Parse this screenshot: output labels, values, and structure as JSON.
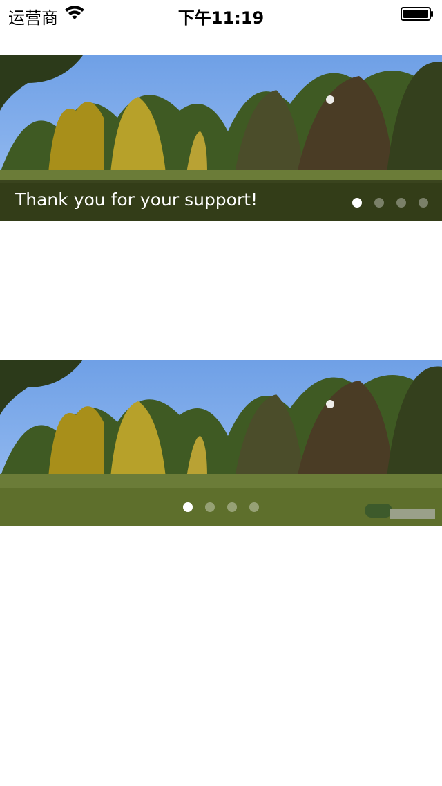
{
  "status_bar": {
    "carrier": "运营商",
    "time": "下午11:19",
    "icons": [
      "wifi-icon",
      "battery-icon"
    ]
  },
  "carousels": [
    {
      "caption": "Thank you for your support!",
      "page_count": 4,
      "current_page": 1
    },
    {
      "caption": "",
      "page_count": 4,
      "current_page": 1
    }
  ]
}
